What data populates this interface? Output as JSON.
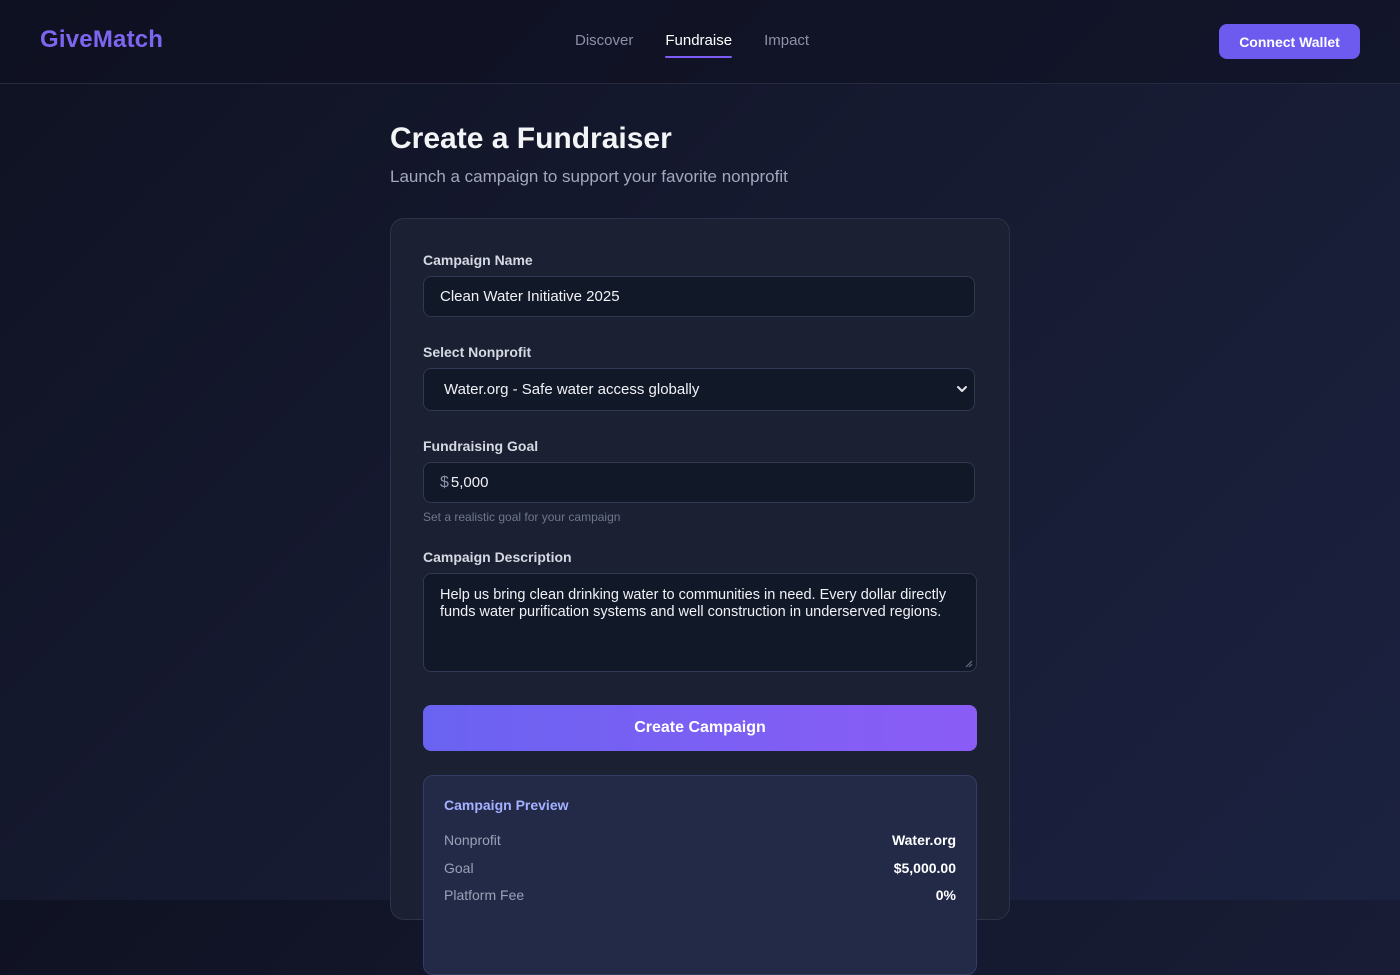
{
  "header": {
    "logo": "GiveMatch",
    "nav": [
      {
        "label": "Discover",
        "active": false
      },
      {
        "label": "Fundraise",
        "active": true
      },
      {
        "label": "Impact",
        "active": false
      }
    ],
    "connect_wallet_label": "Connect Wallet"
  },
  "page": {
    "title": "Create a Fundraiser",
    "subtitle": "Launch a campaign to support your favorite nonprofit"
  },
  "form": {
    "campaign_name": {
      "label": "Campaign Name",
      "value": "Clean Water Initiative 2025"
    },
    "nonprofit": {
      "label": "Select Nonprofit",
      "value": "Water.org - Safe water access globally"
    },
    "goal": {
      "label": "Fundraising Goal",
      "currency_symbol": "$",
      "value": "5,000",
      "hint": "Set a realistic goal for your campaign"
    },
    "description": {
      "label": "Campaign Description",
      "value": "Help us bring clean drinking water to communities in need. Every dollar directly funds water purification systems and well construction in underserved regions."
    },
    "submit_label": "Create Campaign"
  },
  "preview": {
    "title": "Campaign Preview",
    "rows": [
      {
        "key": "Nonprofit",
        "value": "Water.org"
      },
      {
        "key": "Goal",
        "value": "$5,000.00"
      },
      {
        "key": "Platform Fee",
        "value": "0%"
      }
    ]
  },
  "colors": {
    "accent": "#6d5bf0",
    "logo": "#7c66f0",
    "background": "#161a30",
    "card": "#1b2133",
    "preview_title": "#a5b1ff"
  },
  "icons": {
    "select_caret": "chevron-down-icon",
    "textarea_resize": "resize-handle-icon"
  }
}
